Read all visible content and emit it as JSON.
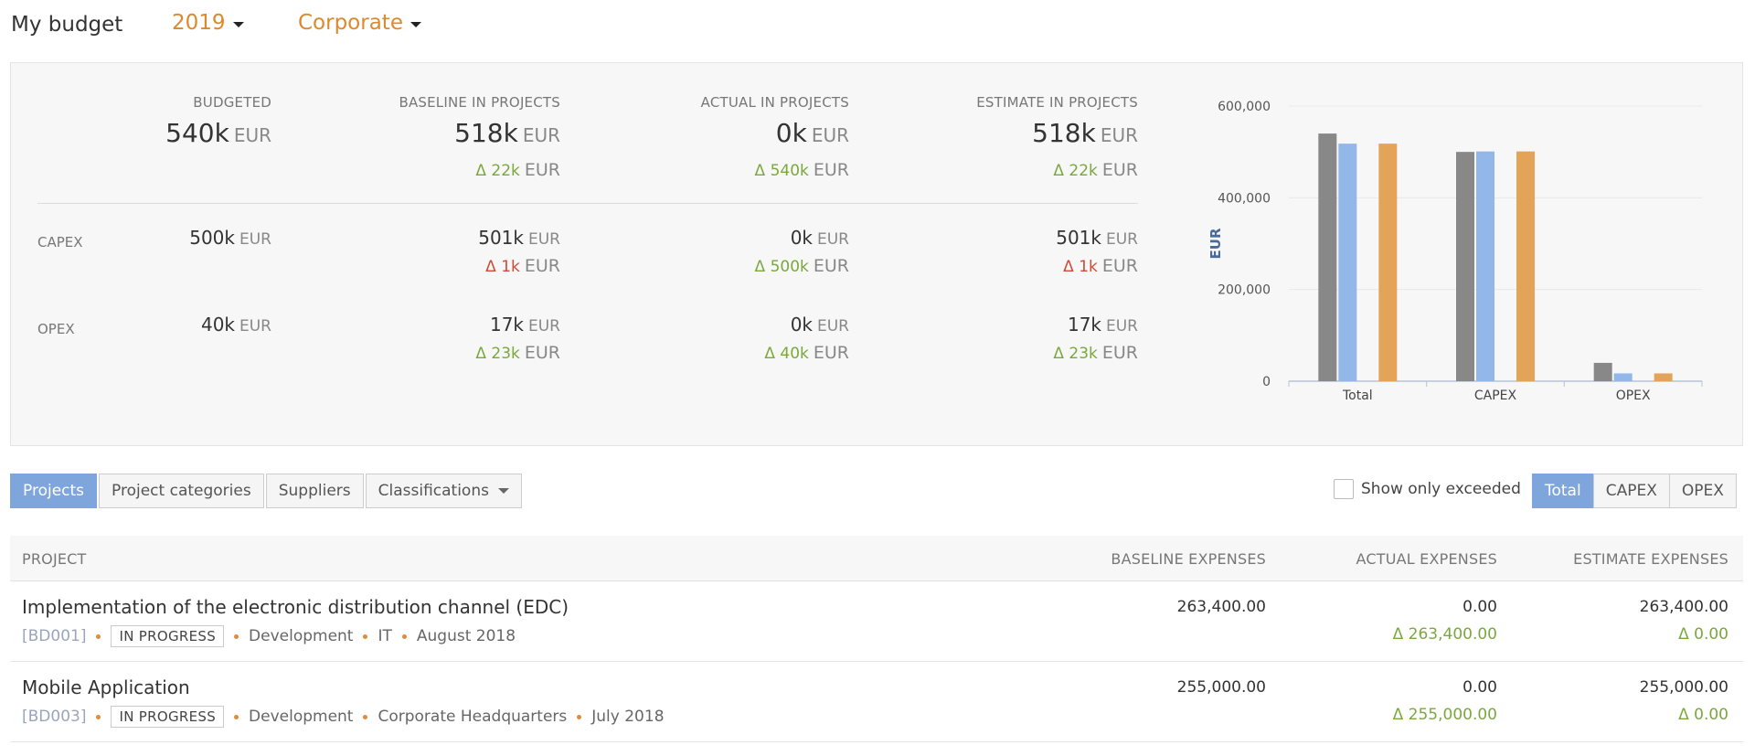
{
  "header": {
    "title": "My budget",
    "year": "2019",
    "scope": "Corporate"
  },
  "summary": {
    "unit": "EUR",
    "columns": [
      "BUDGETED",
      "BASELINE IN PROJECTS",
      "ACTUAL IN PROJECTS",
      "ESTIMATE IN PROJECTS"
    ],
    "total": {
      "budgeted": "540k",
      "baseline": "518k",
      "baseline_delta": "Δ 22k",
      "actual": "0k",
      "actual_delta": "Δ 540k",
      "estimate": "518k",
      "estimate_delta": "Δ 22k"
    },
    "rows": [
      {
        "label": "CAPEX",
        "budgeted": "500k",
        "baseline": "501k",
        "baseline_delta": "Δ 1k",
        "actual": "0k",
        "actual_delta": "Δ 500k",
        "estimate": "501k",
        "estimate_delta": "Δ 1k"
      },
      {
        "label": "OPEX",
        "budgeted": "40k",
        "baseline": "17k",
        "baseline_delta": "Δ 23k",
        "actual": "0k",
        "actual_delta": "Δ 40k",
        "estimate": "17k",
        "estimate_delta": "Δ 23k"
      }
    ]
  },
  "chart_data": {
    "type": "bar",
    "categories": [
      "Total",
      "CAPEX",
      "OPEX"
    ],
    "series": [
      {
        "values": [
          540000,
          500000,
          40000
        ],
        "color": "#888888"
      },
      {
        "values": [
          518000,
          501000,
          17000
        ],
        "color": "#93b7e8"
      },
      {
        "values": [
          0,
          0,
          0
        ],
        "color": "#7aa83d"
      },
      {
        "values": [
          518000,
          501000,
          17000
        ],
        "color": "#e3a45a"
      }
    ],
    "ylabel": "EUR",
    "ylim": [
      0,
      600000
    ],
    "yticks": [
      0,
      200000,
      400000,
      600000
    ],
    "ytick_labels": [
      "0",
      "200,000",
      "400,000",
      "600,000"
    ],
    "grid": true
  },
  "tabs": [
    "Projects",
    "Project categories",
    "Suppliers",
    "Classifications"
  ],
  "filter": {
    "exceeded_label": "Show only exceeded"
  },
  "segments": [
    "Total",
    "CAPEX",
    "OPEX"
  ],
  "table": {
    "headers": [
      "PROJECT",
      "BASELINE EXPENSES",
      "ACTUAL EXPENSES",
      "ESTIMATE EXPENSES"
    ],
    "rows": [
      {
        "name": "Implementation of the electronic distribution channel (EDC)",
        "code": "[BD001]",
        "status": "IN PROGRESS",
        "category": "Development",
        "location": "IT",
        "date": "August 2018",
        "baseline": "263,400.00",
        "actual": "0.00",
        "actual_delta": "Δ 263,400.00",
        "estimate": "263,400.00",
        "estimate_delta": "Δ 0.00"
      },
      {
        "name": "Mobile Application",
        "code": "[BD003]",
        "status": "IN PROGRESS",
        "category": "Development",
        "location": "Corporate Headquarters",
        "date": "July 2018",
        "baseline": "255,000.00",
        "actual": "0.00",
        "actual_delta": "Δ 255,000.00",
        "estimate": "255,000.00",
        "estimate_delta": "Δ 0.00"
      }
    ]
  }
}
